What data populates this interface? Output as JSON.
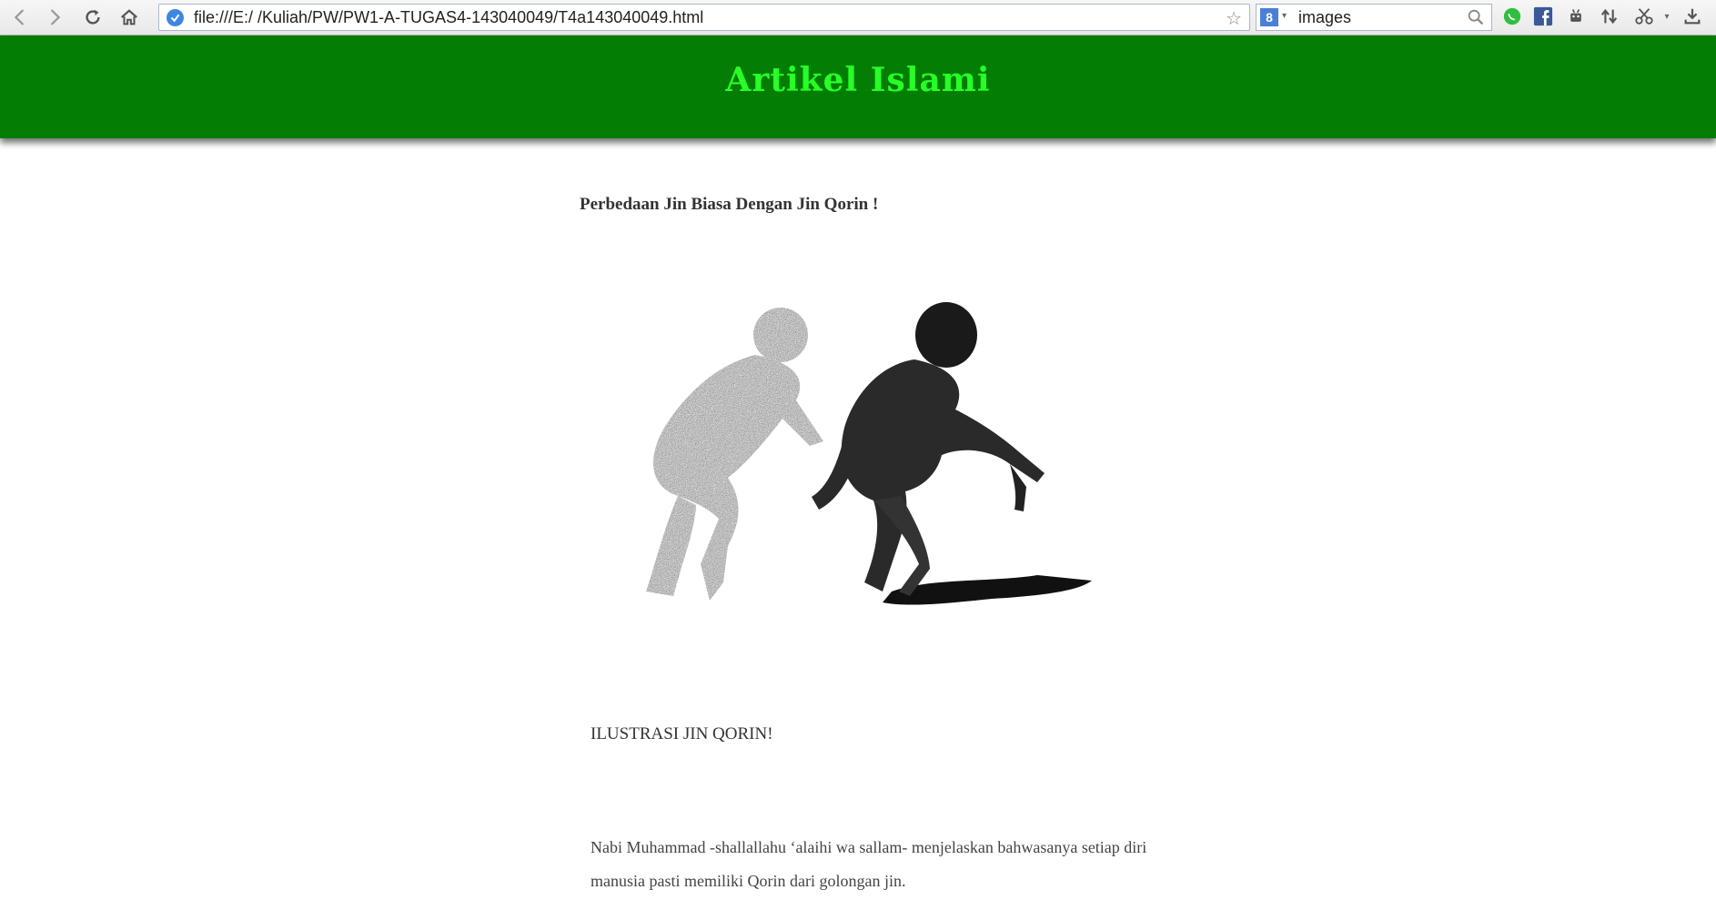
{
  "browser": {
    "url": "file:///E:/ /Kuliah/PW/PW1-A-TUGAS4-143040049/T4a143040049.html",
    "search_query": "images",
    "search_engine_icon": "8",
    "icons": [
      "back-icon",
      "forward-icon",
      "reload-icon",
      "home-icon",
      "secure-icon",
      "star-icon",
      "google-icon",
      "search-icon",
      "whatsapp-icon",
      "facebook-icon",
      "android-icon",
      "sync-icon",
      "scissors-icon",
      "download-icon"
    ]
  },
  "header": {
    "title": "Artikel Islami",
    "background": "#037d03",
    "title_color": "#27ff27"
  },
  "article": {
    "title": "Perbedaan Jin Biasa Dengan Jin Qorin !",
    "caption": "ILUSTRASI JIN QORIN!",
    "paragraph": "Nabi Muhammad -shallallahu ‘alaihi wa sallam- menjelaskan bahwasanya setiap diri manusia pasti memiliki Qorin dari golongan jin."
  }
}
